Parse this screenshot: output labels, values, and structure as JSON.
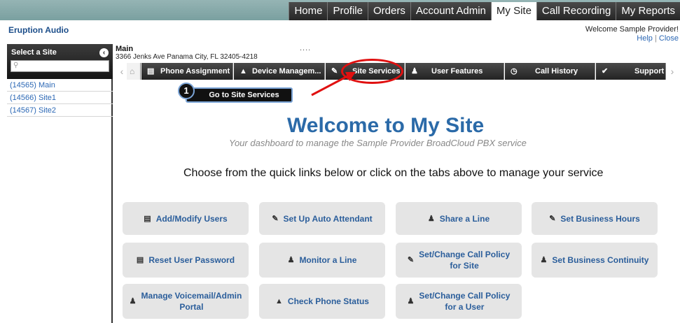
{
  "topnav": {
    "tabs": [
      "Home",
      "Profile",
      "Orders",
      "Account Admin",
      "My Site",
      "Call Recording",
      "My Reports"
    ],
    "active": "My Site"
  },
  "brand": "Eruption Audio",
  "user": {
    "welcome": "Welcome Sample Provider!",
    "help": "Help",
    "close": "Close"
  },
  "sidebar": {
    "title": "Select a Site",
    "search_placeholder": "",
    "sites": [
      "(14565) Main",
      "(14566) Site1",
      "(14567) Site2"
    ]
  },
  "site": {
    "name": "Main",
    "address": "3366 Jenks Ave Panama City, FL 32405-4218",
    "dots": "...."
  },
  "tabs": {
    "phone_assignment": "Phone Assignment",
    "device_management": "Device Managem...",
    "site_services": "Site Services",
    "user_features": "User Features",
    "call_history": "Call History",
    "support": "Support"
  },
  "annotation": {
    "step": "1",
    "text": "Go to Site Services"
  },
  "welcome": {
    "title": "Welcome to My Site",
    "subtitle": "Your dashboard to manage the Sample Provider BroadCloud PBX service",
    "choose": "Choose from the quick links below or click on the tabs above to manage your service"
  },
  "quick_links": {
    "add_modify_users": "Add/Modify Users",
    "auto_attendant": "Set Up Auto Attendant",
    "share_line": "Share a Line",
    "business_hours": "Set Business Hours",
    "reset_password": "Reset User Password",
    "monitor_line": "Monitor a Line",
    "call_policy_site_1": "Set/Change Call Policy",
    "call_policy_site_2": "for Site",
    "business_continuity": "Set Business Continuity",
    "voicemail_1": "Manage Voicemail/Admin",
    "voicemail_2": "Portal",
    "phone_status": "Check Phone Status",
    "call_policy_user_1": "Set/Change Call Policy",
    "call_policy_user_2": "for a User"
  },
  "colors": {
    "accent_blue": "#2b6aa8",
    "link_blue": "#2c68b5",
    "annotation_red": "#e01010"
  }
}
